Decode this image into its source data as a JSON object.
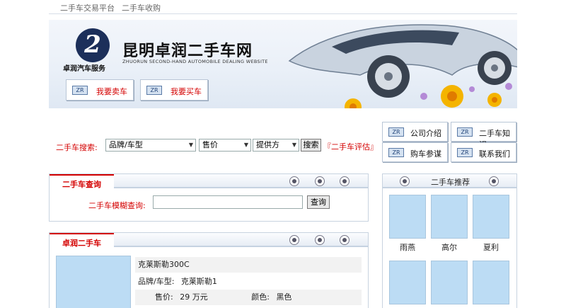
{
  "top_nav": [
    "二手车交易平台",
    "二手车收购"
  ],
  "banner": {
    "logo_glyph": "2",
    "logo_caption": "卓润汽车服务",
    "title": "昆明卓润二手车网",
    "subtitle": "ZHUORUN SECOND-HAND AUTOMOBILE DEALING WEBSITE",
    "buttons": [
      "我要卖车",
      "我要买车"
    ]
  },
  "search": {
    "label": "二手车搜索:",
    "select_brand": "品牌/车型",
    "select_price": "售价",
    "select_provider": "提供方",
    "search_button": "搜索",
    "eval_link": "『二手车评估』"
  },
  "right_nav": [
    "公司介绍",
    "二手车知识",
    "购车参谋",
    "联系我们"
  ],
  "query_panel": {
    "tab": "二手车查询",
    "fuzzy_label": "二手车模糊查询:",
    "query_button": "查询"
  },
  "listing_panel": {
    "tab": "卓润二手车",
    "car_name": "克莱斯勒300C",
    "brand_label": "品牌/车型:",
    "brand_value": "克莱斯勒1",
    "price_label": "售价:",
    "price_value": "29 万元",
    "color_label": "颜色:",
    "color_value": "黑色"
  },
  "recommend_panel": {
    "title": "二手车推荐",
    "cars": [
      "雨燕",
      "高尔",
      "夏利"
    ]
  },
  "colors": {
    "accent_red": "#d40000",
    "banner_bg": "#eaf0f8",
    "thumb_blue": "#bcdcf4"
  }
}
